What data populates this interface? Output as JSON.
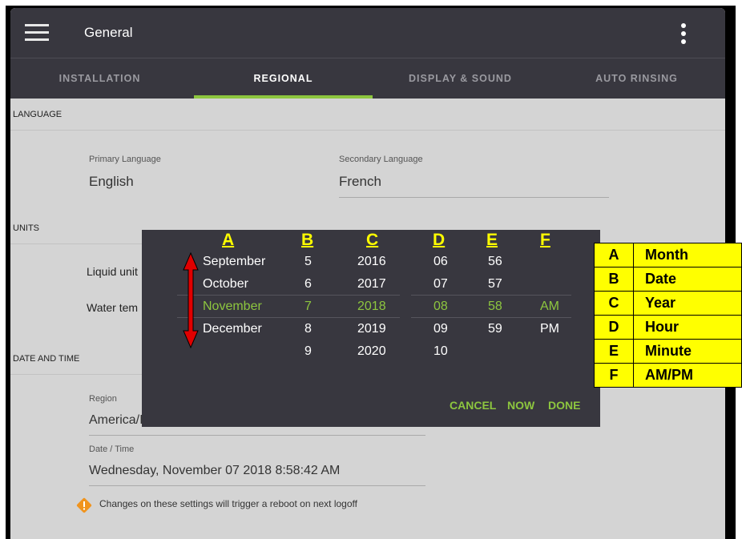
{
  "appbar": {
    "title": "General"
  },
  "tabs": [
    {
      "label": "INSTALLATION",
      "active": false
    },
    {
      "label": "REGIONAL",
      "active": true
    },
    {
      "label": "DISPLAY & SOUND",
      "active": false
    },
    {
      "label": "AUTO RINSING",
      "active": false
    }
  ],
  "language": {
    "header": "LANGUAGE",
    "primary_label": "Primary Language",
    "primary_value": "English",
    "secondary_label": "Secondary Language",
    "secondary_value": "French"
  },
  "units": {
    "header": "UNITS",
    "liquid_label": "Liquid unit",
    "water_label": "Water tem"
  },
  "datetime": {
    "header": "DATE AND TIME",
    "region_label": "Region",
    "region_value": "America/I",
    "datetime_label": "Date / Time",
    "datetime_value": "Wednesday, November 07 2018 8:58:42 AM"
  },
  "warning": {
    "text": "Changes on these settings will trigger a reboot on next logoff"
  },
  "picker": {
    "months": [
      "September",
      "October",
      "November",
      "December"
    ],
    "dates": [
      "5",
      "6",
      "7",
      "8",
      "9"
    ],
    "years": [
      "2016",
      "2017",
      "2018",
      "2019",
      "2020"
    ],
    "hours": [
      "06",
      "07",
      "08",
      "09",
      "10"
    ],
    "minutes": [
      "56",
      "57",
      "58",
      "59"
    ],
    "ampm": [
      "AM",
      "PM"
    ],
    "selected": {
      "month": "November",
      "date": "7",
      "year": "2018",
      "hour": "08",
      "minute": "58",
      "ampm": "AM"
    },
    "cancel_label": "CANCEL",
    "now_label": "NOW",
    "done_label": "DONE"
  },
  "annotation": {
    "letters": [
      "A",
      "B",
      "C",
      "D",
      "E",
      "F"
    ],
    "legend": [
      {
        "key": "A",
        "value": "Month"
      },
      {
        "key": "B",
        "value": "Date"
      },
      {
        "key": "C",
        "value": "Year"
      },
      {
        "key": "D",
        "value": "Hour"
      },
      {
        "key": "E",
        "value": "Minute"
      },
      {
        "key": "F",
        "value": "AM/PM"
      }
    ],
    "arrow_color": "#e00000",
    "highlight_color": "#ffff00"
  },
  "colors": {
    "accent": "#8dc63f",
    "appbar": "#38373f",
    "content_bg": "#d4d4d4",
    "warning": "#f0941e"
  }
}
